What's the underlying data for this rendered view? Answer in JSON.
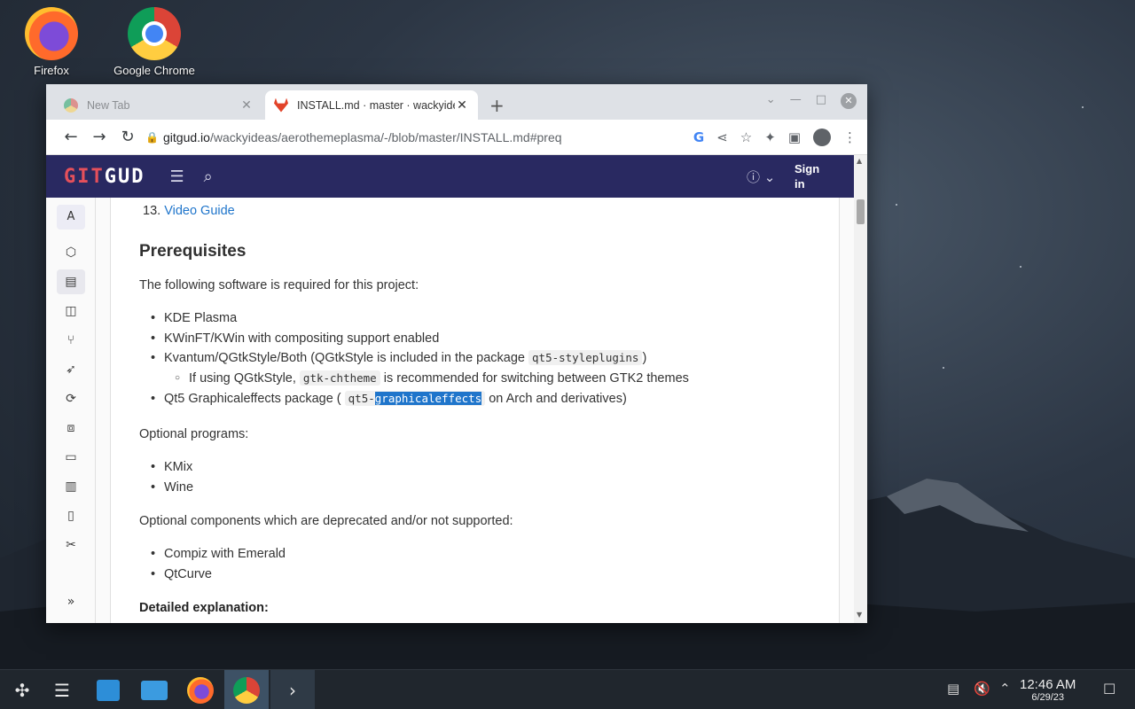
{
  "desktop": {
    "icons": [
      {
        "label": "Firefox"
      },
      {
        "label": "Google Chrome"
      }
    ]
  },
  "browser": {
    "tabs": [
      {
        "title": "New Tab",
        "active": false
      },
      {
        "title": "INSTALL.md · master · wackyideas / aerothemeplasma · GitGud",
        "active": true
      }
    ],
    "url_domain": "gitgud.io",
    "url_path": "/wackyideas/aerothemeplasma/-/blob/master/INSTALL.md#preq"
  },
  "gitlab": {
    "logo_git": "GIT",
    "logo_gud": "GUD",
    "sign_in": "Sign in",
    "sidebar_avatar": "A"
  },
  "content": {
    "ol_number": "13.",
    "ol_link": "Video Guide",
    "heading": "Prerequisites",
    "intro": "The following software is required for this project:",
    "required": {
      "item1": "KDE Plasma",
      "item2": "KWinFT/KWin with compositing support enabled",
      "item3_pre": "Kvantum/QGtkStyle/Both (QGtkStyle is included in the package",
      "item3_code": "qt5-styleplugins",
      "item3_post": ")",
      "sub_pre": "If using QGtkStyle,",
      "sub_code": "gtk-chtheme",
      "sub_post": "is recommended for switching between GTK2 themes",
      "item4_pre": "Qt5 Graphicaleffects package (",
      "item4_code_a": "qt5-",
      "item4_code_sel": "graphicaleffects",
      "item4_post": "on Arch and derivatives)"
    },
    "optional_intro": "Optional programs:",
    "optional": [
      "KMix",
      "Wine"
    ],
    "deprecated_intro": "Optional components which are deprecated and/or not supported:",
    "deprecated": [
      "Compiz with Emerald",
      "QtCurve"
    ],
    "detailed": "Detailed explanation:"
  },
  "taskbar": {
    "time": "12:46 AM",
    "date": "6/29/23"
  },
  "colors": {
    "gitlab_header": "#292961",
    "link": "#1f75cb",
    "selection": "#1f75cb"
  }
}
